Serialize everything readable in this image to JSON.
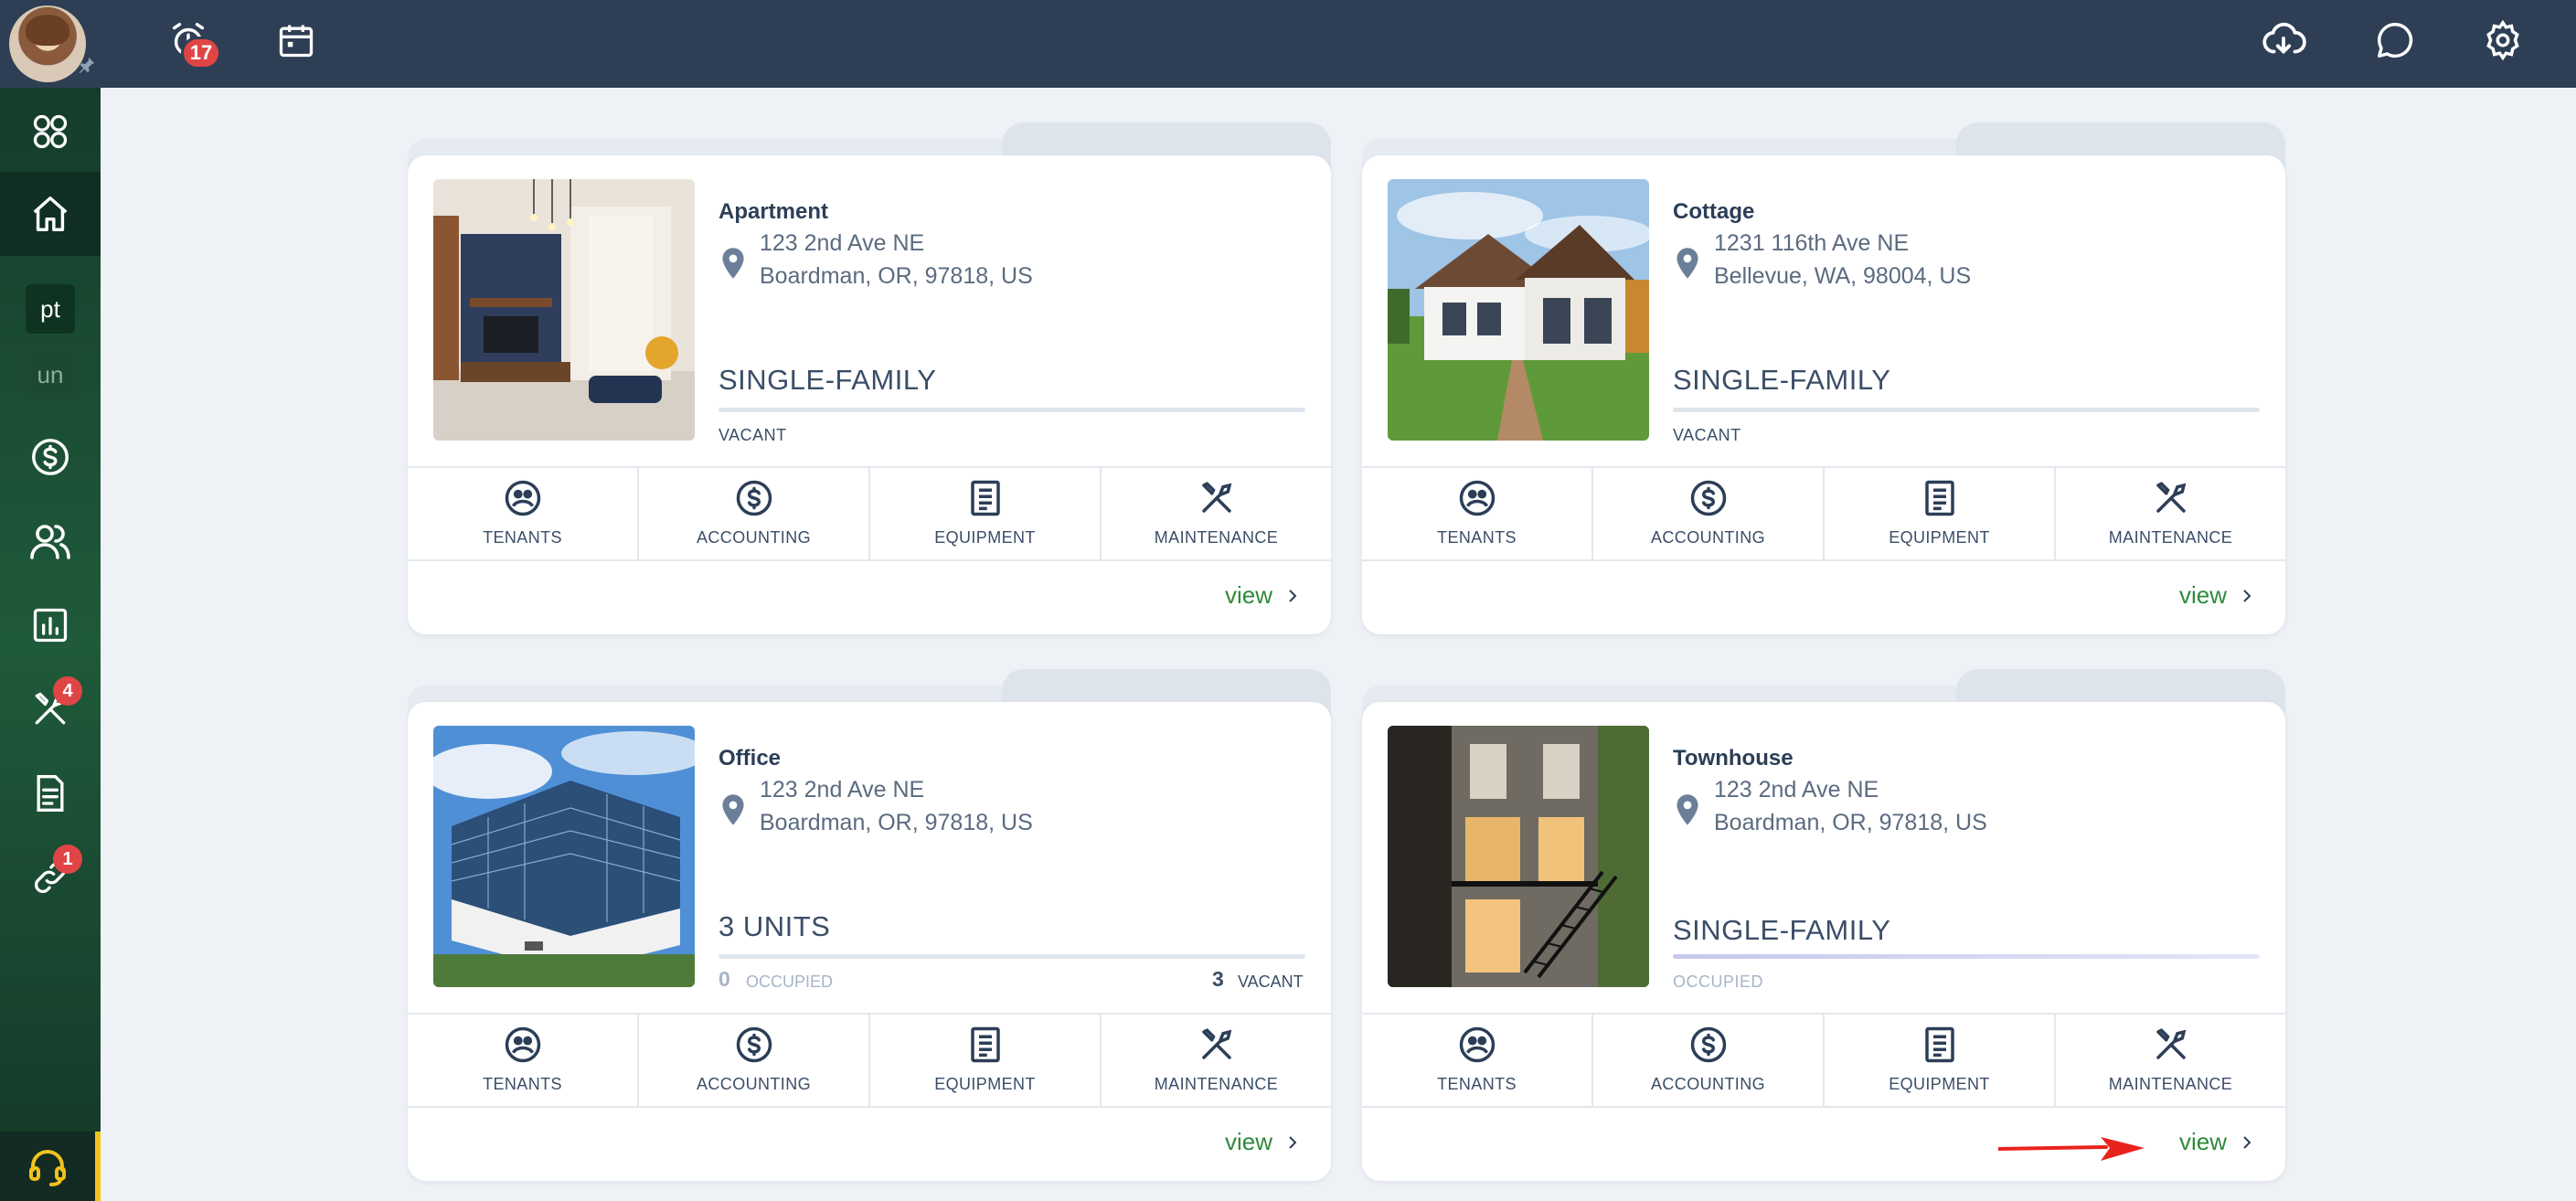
{
  "topbar": {
    "alarm_badge": "17",
    "icons": [
      "alarm-clock-icon",
      "calendar-icon",
      "cloud-download-icon",
      "chat-icon",
      "gear-icon"
    ]
  },
  "sidebar": {
    "items": [
      {
        "icon": "grid-icon"
      },
      {
        "icon": "home-icon",
        "active": true
      },
      {
        "label": "pt"
      },
      {
        "label": "un"
      },
      {
        "icon": "dollar-icon"
      },
      {
        "icon": "users-icon"
      },
      {
        "icon": "chart-icon"
      },
      {
        "icon": "tools-icon",
        "badge": "4"
      },
      {
        "icon": "document-icon"
      },
      {
        "icon": "link-icon",
        "badge": "1"
      }
    ],
    "help_icon": "headset-icon"
  },
  "actions": {
    "tenants": "TENANTS",
    "accounting": "ACCOUNTING",
    "equipment": "EQUIPMENT",
    "maintenance": "MAINTENANCE"
  },
  "view_label": "view",
  "properties": [
    {
      "name": "Apartment",
      "address1": "123 2nd Ave NE",
      "address2": "Boardman, OR, 97818, US",
      "type": "SINGLE-FAMILY",
      "status": "VACANT"
    },
    {
      "name": "Cottage",
      "address1": "1231 116th Ave NE",
      "address2": "Bellevue, WA, 98004, US",
      "type": "SINGLE-FAMILY",
      "status": "VACANT"
    },
    {
      "name": "Office",
      "address1": "123 2nd Ave NE",
      "address2": "Boardman, OR, 97818, US",
      "type": "3 UNITS",
      "occupied_count": "0",
      "occupied_label": "OCCUPIED",
      "vacant_count": "3",
      "vacant_label": "VACANT"
    },
    {
      "name": "Townhouse",
      "address1": "123 2nd Ave NE",
      "address2": "Boardman, OR, 97818, US",
      "type": "SINGLE-FAMILY",
      "status": "OCCUPIED"
    }
  ],
  "colors": {
    "topbar": "#2e3f55",
    "sidebar": "#1f5a3a",
    "link_green": "#2f8a3a",
    "badge_red": "#e04545",
    "help_accent": "#f0c21b"
  }
}
